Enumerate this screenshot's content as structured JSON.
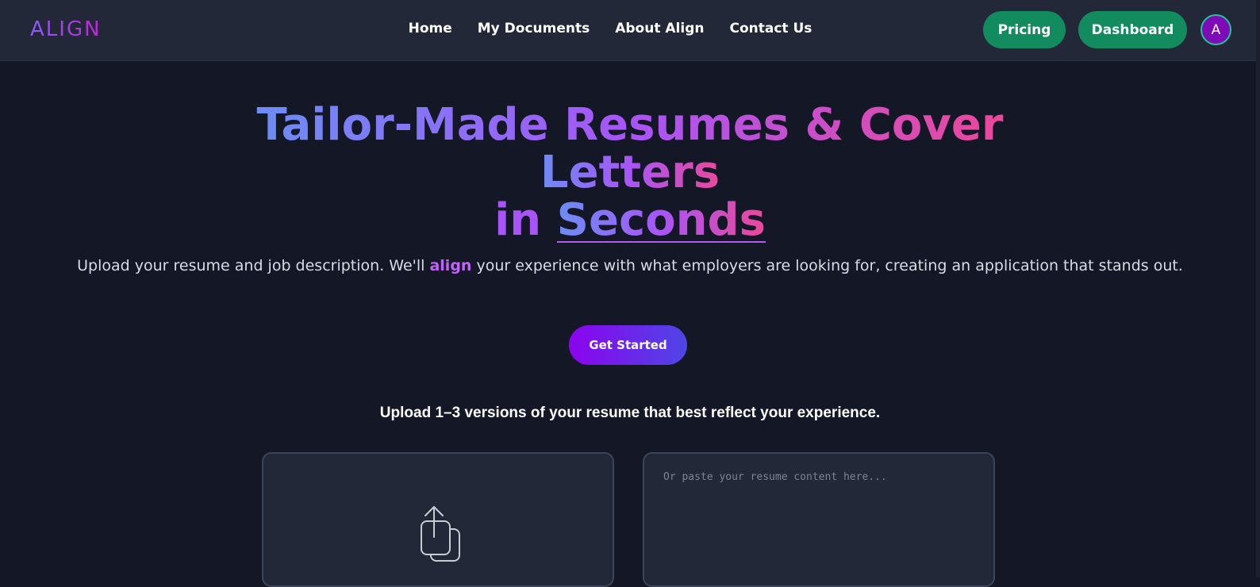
{
  "brand": {
    "logo_text": "ALIGN"
  },
  "nav": {
    "links": [
      "Home",
      "My Documents",
      "About Align",
      "Contact Us"
    ],
    "pricing_label": "Pricing",
    "dashboard_label": "Dashboard",
    "avatar_initial": "A"
  },
  "hero": {
    "title_line1": "Tailor-Made Resumes & Cover",
    "title_line2": "Letters",
    "title_in": "in",
    "title_seconds": "Seconds",
    "subtitle_part1": "Upload your resume and job description. We'll ",
    "subtitle_highlight": "align",
    "subtitle_part2": " your experience with what employers are looking for, creating an application that stands out.",
    "cta_label": "Get Started"
  },
  "upload": {
    "heading": "Upload 1–3 versions of your resume that best reflect your experience.",
    "paste_placeholder": "Or paste your resume content here..."
  },
  "colors": {
    "background": "#141726",
    "navbar": "#232838",
    "green_button": "#128c5e",
    "accent_purple": "#a855f7",
    "accent_pink": "#ec4899",
    "avatar_bg": "#7e0ab8"
  },
  "icons": [
    "upload-share-icon"
  ]
}
